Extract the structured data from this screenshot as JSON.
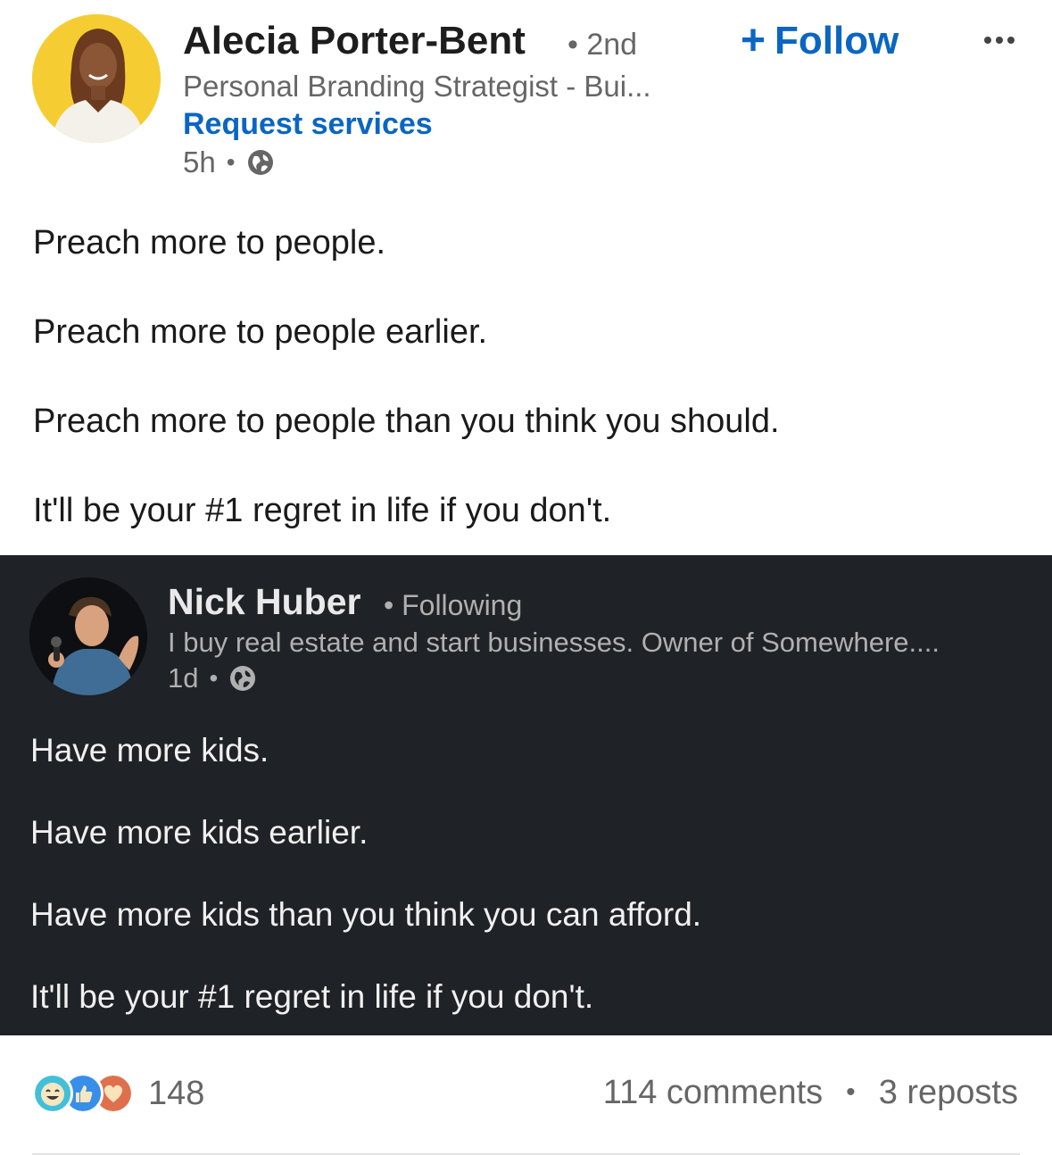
{
  "colors": {
    "brand_blue": "#0a66c2",
    "embed_background": "#1f2226",
    "avatar_main_background": "#f5cd33"
  },
  "post": {
    "author": {
      "name": "Alecia Porter-Bent",
      "degree": "• 2nd",
      "headline": "Personal Branding Strategist - Bui...",
      "request_services": "Request services",
      "time": "5h",
      "visibility_icon": "globe-icon"
    },
    "follow_plus": "+",
    "follow_label": "Follow",
    "more_icon": "more-options-icon",
    "body_lines": [
      "Preach more to people.",
      "Preach more to people earlier.",
      "Preach more to people than you think you should.",
      "It'll be your #1 regret in life if you don't."
    ]
  },
  "embedded_post": {
    "author": {
      "name": "Nick Huber",
      "status": "• Following",
      "headline": "I buy real estate and start businesses. Owner of Somewhere....",
      "time": "1d",
      "visibility_icon": "globe-icon"
    },
    "body_lines": [
      "Have more kids.",
      "Have more kids earlier.",
      "Have more kids than you think you can afford.",
      "It'll be your #1 regret in life if you don't."
    ]
  },
  "social": {
    "reaction_icons": [
      "funny-reaction-icon",
      "like-reaction-icon",
      "love-reaction-icon"
    ],
    "reaction_count": "148",
    "comments": "114 comments",
    "reposts": "3 reposts"
  }
}
